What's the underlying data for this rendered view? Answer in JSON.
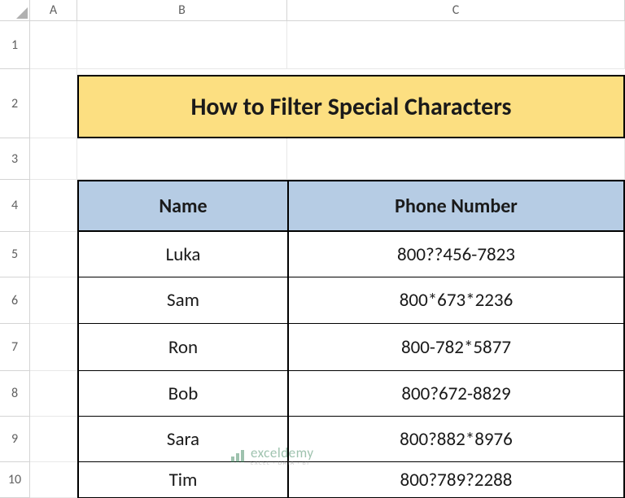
{
  "columns": [
    "A",
    "B",
    "C"
  ],
  "rows": [
    "1",
    "2",
    "3",
    "4",
    "5",
    "6",
    "7",
    "8",
    "9",
    "10"
  ],
  "title": "How to Filter Special Characters",
  "headers": {
    "name": "Name",
    "phone": "Phone Number"
  },
  "data": [
    {
      "name": "Luka",
      "phone": "800??456-7823"
    },
    {
      "name": "Sam",
      "phone": "800*673*2236"
    },
    {
      "name": "Ron",
      "phone": "800-782*5877"
    },
    {
      "name": "Bob",
      "phone": "800?672-8829"
    },
    {
      "name": "Sara",
      "phone": "800?882*8976"
    },
    {
      "name": "Tim",
      "phone": "800?789?2288"
    }
  ],
  "watermark": {
    "main": "exceldemy",
    "sub": "EXCEL · DATA · BI"
  }
}
